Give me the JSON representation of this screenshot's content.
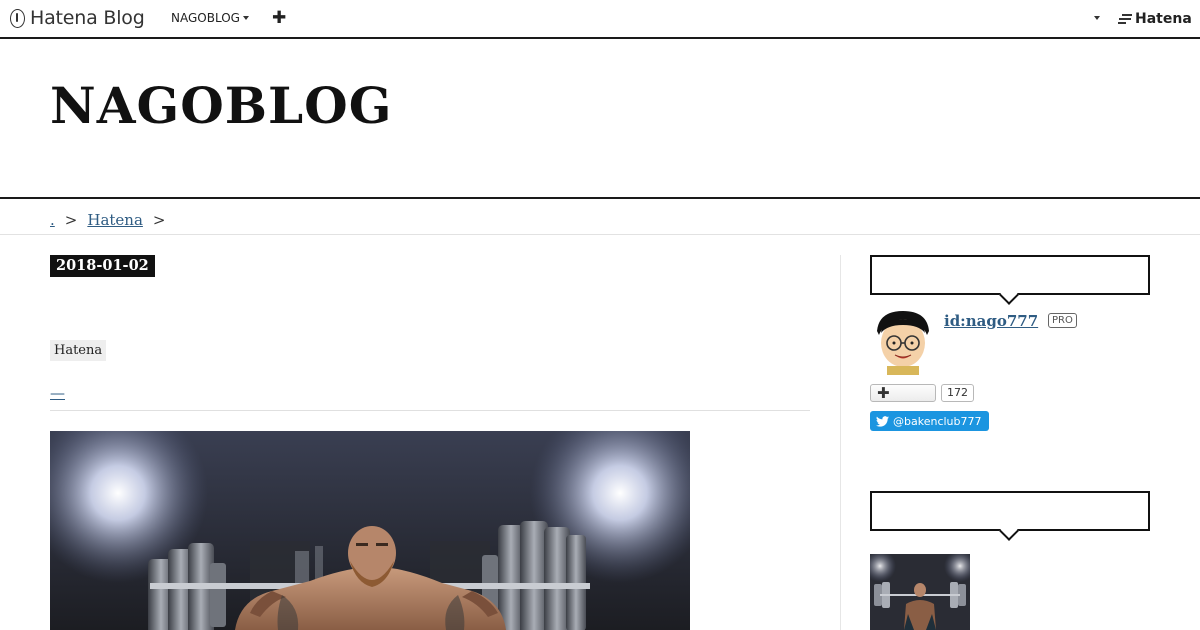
{
  "topbar": {
    "brand": "Hatena Blog",
    "blog_menu": "NAGOBLOG",
    "add_label": "✚",
    "hatena_label": "Hatena"
  },
  "header": {
    "title": "NAGOBLOG"
  },
  "breadcrumb": {
    "items": [
      ".",
      "Hatena"
    ],
    "separator": ">"
  },
  "entry": {
    "date": "2018-01-02",
    "category": "Hatena",
    "title_link": "—",
    "hero_icon": "weightlifter-photo"
  },
  "sidebar": {
    "profile": {
      "id": "id:nago777",
      "badge": "PRO",
      "avatar_icon": "avatar-glasses-man"
    },
    "bookmark": {
      "plus": "✚",
      "count": "172"
    },
    "twitter": {
      "handle": "@bakenclub777",
      "color": "#1b95e0"
    },
    "thumbnail_icon": "weightlifter-thumb"
  },
  "colors": {
    "link": "#2f5c83",
    "text": "#111111",
    "badge_bg": "#111111",
    "tag_bg": "#eeeeee"
  }
}
